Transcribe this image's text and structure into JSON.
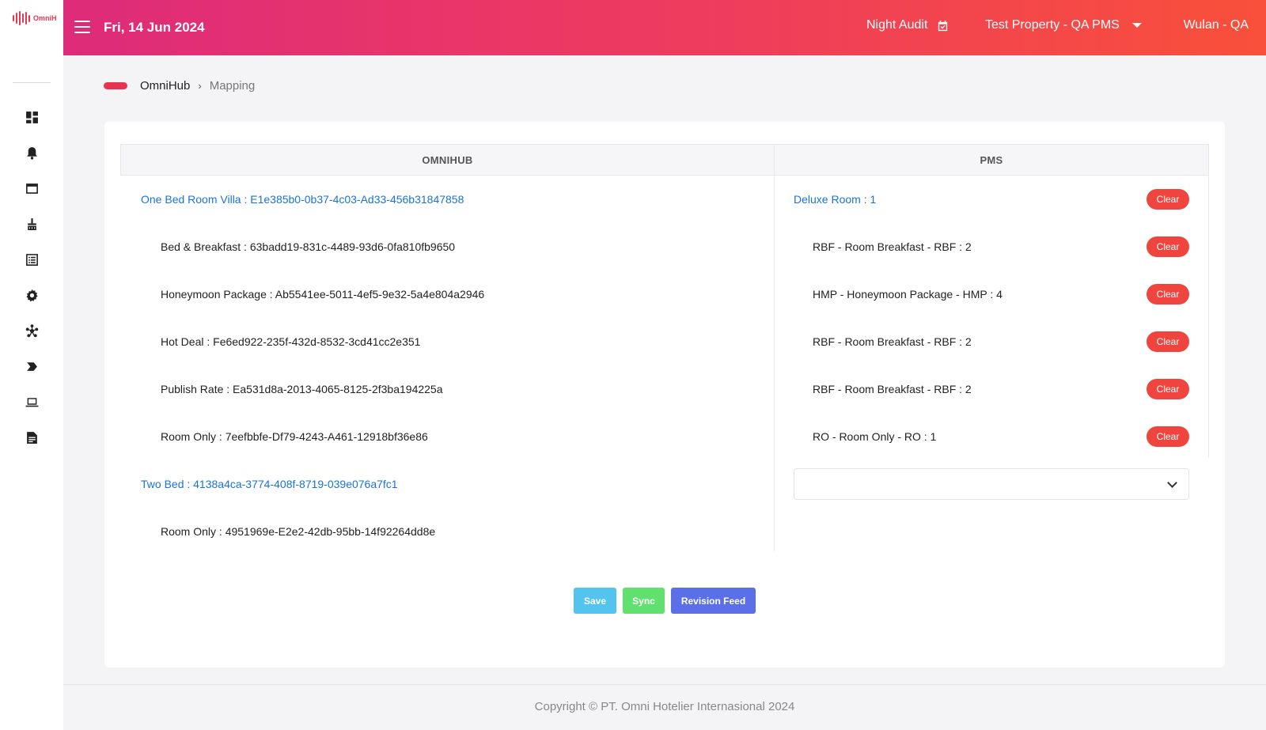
{
  "brand": {
    "logo_text": "OmniH",
    "accent": "#e8334e"
  },
  "topbar": {
    "date": "Fri, 14 Jun 2024",
    "night_audit": "Night Audit",
    "property": "Test Property - QA PMS",
    "user": "Wulan - QA"
  },
  "sidebar": {
    "items": [
      {
        "icon": "dashboard-icon"
      },
      {
        "icon": "bell-icon"
      },
      {
        "icon": "window-icon"
      },
      {
        "icon": "housekeeping-icon"
      },
      {
        "icon": "list-icon"
      },
      {
        "icon": "gear-icon"
      },
      {
        "icon": "network-icon"
      },
      {
        "icon": "chevron-tag-icon"
      },
      {
        "icon": "laptop-icon"
      },
      {
        "icon": "report-icon"
      }
    ]
  },
  "breadcrumb": {
    "home": "OmniHub",
    "separator": "›",
    "current": "Mapping"
  },
  "table": {
    "headers": {
      "omnihub": "OMNIHUB",
      "pms": "PMS"
    },
    "left_rows": [
      {
        "type": "parent",
        "text": "One Bed Room Villa : E1e385b0-0b37-4c03-Ad33-456b31847858"
      },
      {
        "type": "child",
        "text": "Bed & Breakfast : 63badd19-831c-4489-93d6-0fa810fb9650"
      },
      {
        "type": "child",
        "text": "Honeymoon Package : Ab5541ee-5011-4ef5-9e32-5a4e804a2946"
      },
      {
        "type": "child",
        "text": "Hot Deal : Fe6ed922-235f-432d-8532-3cd41cc2e351"
      },
      {
        "type": "child",
        "text": "Publish Rate : Ea531d8a-2013-4065-8125-2f3ba194225a"
      },
      {
        "type": "child",
        "text": "Room Only : 7eefbbfe-Df79-4243-A461-12918bf36e86"
      },
      {
        "type": "parent",
        "text": "Two Bed : 4138a4ca-3774-408f-8719-039e076a7fc1"
      },
      {
        "type": "child",
        "text": "Room Only : 4951969e-E2e2-42db-95bb-14f92264dd8e"
      }
    ],
    "right_rows": [
      {
        "type": "parent",
        "text": "Deluxe Room : 1",
        "button": "Clear"
      },
      {
        "type": "child",
        "text": "RBF - Room Breakfast - RBF : 2",
        "button": "Clear"
      },
      {
        "type": "child",
        "text": "HMP - Honeymoon Package - HMP : 4",
        "button": "Clear"
      },
      {
        "type": "child",
        "text": "RBF - Room Breakfast - RBF : 2",
        "button": "Clear"
      },
      {
        "type": "child",
        "text": "RBF - Room Breakfast - RBF : 2",
        "button": "Clear"
      },
      {
        "type": "child",
        "text": "RO - Room Only - RO : 1",
        "button": "Clear"
      }
    ],
    "select_value": ""
  },
  "actions": {
    "save": "Save",
    "sync": "Sync",
    "revision_feed": "Revision Feed"
  },
  "footer": {
    "copyright": "Copyright © PT. Omni Hotelier Internasional 2024"
  },
  "colors": {
    "link": "#1a73d9",
    "clear": "#f0453e",
    "save": "#53c3f0",
    "sync": "#5fe06f",
    "revision": "#5b6fe8"
  }
}
